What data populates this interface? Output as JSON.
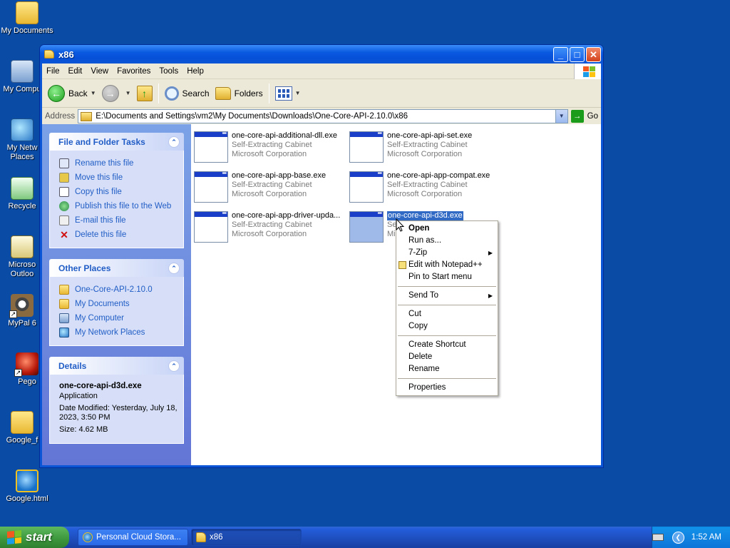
{
  "desktop": {
    "icons": [
      {
        "label": "My Documents",
        "icon": "my-documents-icon"
      },
      {
        "label": "My Compu",
        "icon": "my-computer-icon"
      },
      {
        "label": "My Netw Places",
        "icon": "network-places-icon"
      },
      {
        "label": "Recycle",
        "icon": "recycle-bin-icon"
      },
      {
        "label": "Microso Outloo",
        "icon": "outlook-icon"
      },
      {
        "label": "MyPal 6",
        "icon": "mypal-icon"
      },
      {
        "label": "Pego",
        "icon": "pego-icon"
      },
      {
        "label": "Google_f",
        "icon": "folder-icon"
      },
      {
        "label": "Google.html",
        "icon": "ie-html-icon"
      }
    ]
  },
  "window": {
    "title": "x86",
    "menu": [
      "File",
      "Edit",
      "View",
      "Favorites",
      "Tools",
      "Help"
    ],
    "toolbar": {
      "back": "Back",
      "search": "Search",
      "folders": "Folders"
    },
    "address": {
      "label": "Address",
      "path": "E:\\Documents and Settings\\vm2\\My Documents\\Downloads\\One-Core-API-2.10.0\\x86",
      "go": "Go"
    }
  },
  "taskpane": {
    "file_tasks": {
      "title": "File and Folder Tasks",
      "items": [
        "Rename this file",
        "Move this file",
        "Copy this file",
        "Publish this file to the Web",
        "E-mail this file",
        "Delete this file"
      ]
    },
    "other_places": {
      "title": "Other Places",
      "items": [
        "One-Core-API-2.10.0",
        "My Documents",
        "My Computer",
        "My Network Places"
      ]
    },
    "details": {
      "title": "Details",
      "name": "one-core-api-d3d.exe",
      "type": "Application",
      "modified": "Date Modified: Yesterday, July 18, 2023, 3:50 PM",
      "size": "Size: 4.62 MB"
    }
  },
  "files": [
    {
      "name": "one-core-api-additional-dll.exe",
      "type": "Self-Extracting Cabinet",
      "company": "Microsoft Corporation"
    },
    {
      "name": "one-core-api-api-set.exe",
      "type": "Self-Extracting Cabinet",
      "company": "Microsoft Corporation"
    },
    {
      "name": "one-core-api-app-base.exe",
      "type": "Self-Extracting Cabinet",
      "company": "Microsoft Corporation"
    },
    {
      "name": "one-core-api-app-compat.exe",
      "type": "Self-Extracting Cabinet",
      "company": "Microsoft Corporation"
    },
    {
      "name": "one-core-api-app-driver-upda...",
      "type": "Self-Extracting Cabinet",
      "company": "Microsoft Corporation"
    },
    {
      "name": "one-core-api-d3d.exe",
      "type": "Se",
      "company": "Mic"
    }
  ],
  "context_menu": {
    "open": "Open",
    "run_as": "Run as...",
    "zip": "7-Zip",
    "notepad": "Edit with Notepad++",
    "pin": "Pin to Start menu",
    "send_to": "Send To",
    "cut": "Cut",
    "copy": "Copy",
    "create_shortcut": "Create Shortcut",
    "delete": "Delete",
    "rename": "Rename",
    "properties": "Properties"
  },
  "taskbar": {
    "start": "start",
    "tasks": [
      "Personal Cloud Stora...",
      "x86"
    ],
    "clock": "1:52 AM"
  }
}
